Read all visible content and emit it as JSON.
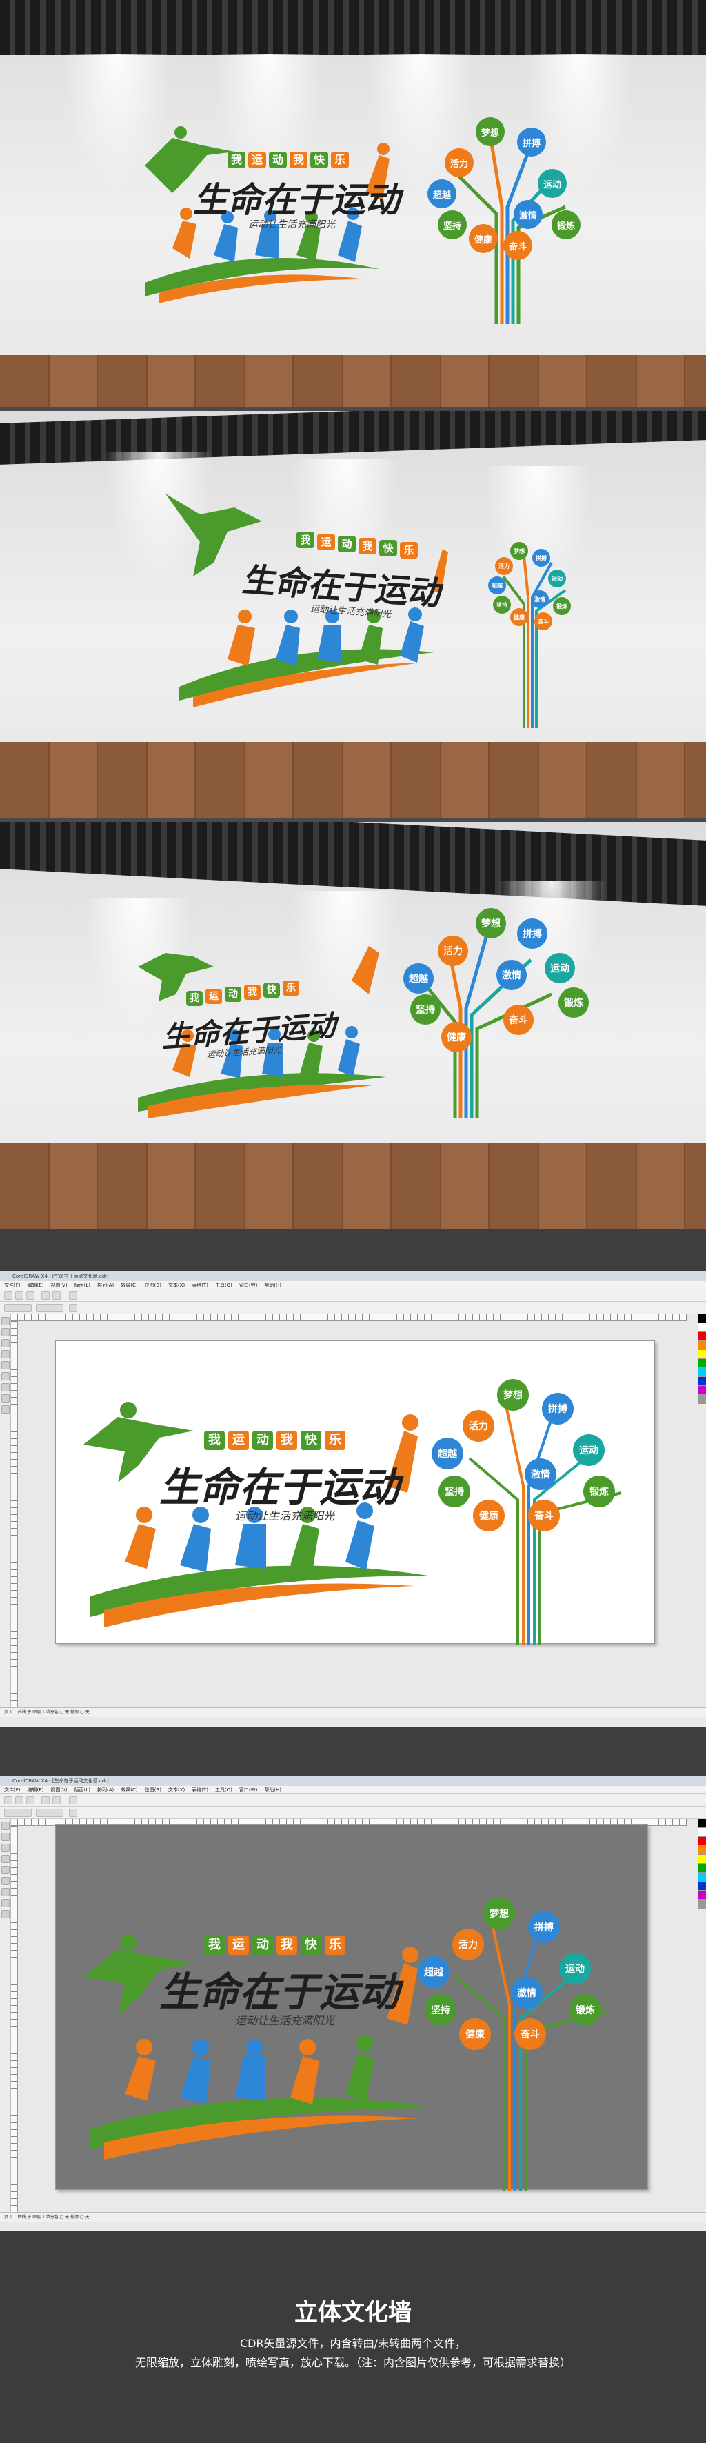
{
  "artwork": {
    "slogan": [
      "我",
      "运",
      "动",
      "我",
      "快",
      "乐"
    ],
    "main_title": "生命在于运动",
    "subtitle": "运动让生活充满阳光",
    "tree_words": [
      "梦想",
      "活力",
      "拼搏",
      "超越",
      "运动",
      "坚持",
      "激情",
      "锻炼",
      "健康",
      "奋斗"
    ],
    "colors": {
      "green": "#4a9a2c",
      "orange": "#ee7a1a",
      "blue": "#2e86d6",
      "teal": "#1aa7a0",
      "dark": "#222222"
    }
  },
  "cdr_window": {
    "title": "CorelDRAW X4 - [生命在于运动文化墙.cdr]",
    "menu": [
      "文件(F)",
      "编辑(E)",
      "视图(V)",
      "版面(L)",
      "排列(A)",
      "效果(C)",
      "位图(B)",
      "文本(X)",
      "表格(T)",
      "工具(O)",
      "窗口(W)",
      "帮助(H)"
    ],
    "status_text": "曲线 于 图层 1  填充色 ▢ 无  轮廓 ▢ 无",
    "page_tab": "页 1"
  },
  "footer": {
    "title": "立体文化墙",
    "line1": "CDR矢量源文件，内含转曲/未转曲两个文件，",
    "line2": "无限缩放，立体雕刻，喷绘写真，放心下载。（注：内含图片仅供参考，可根据需求替换）"
  }
}
